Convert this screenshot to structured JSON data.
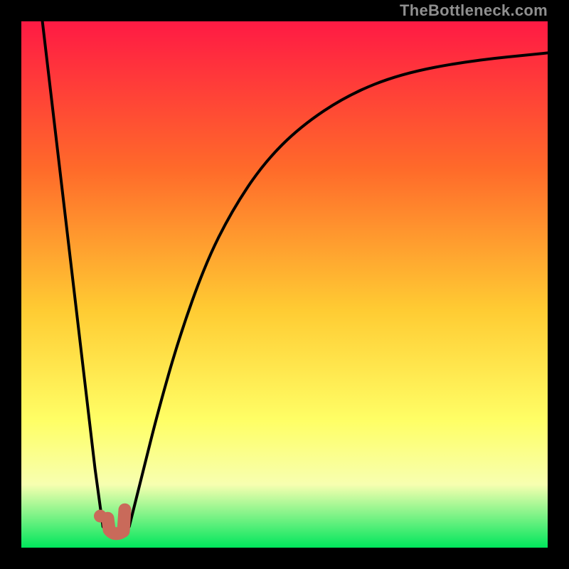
{
  "watermark": "TheBottleneck.com",
  "colors": {
    "frame": "#000000",
    "gradient_top": "#ff1a44",
    "gradient_mid1": "#ff6a2a",
    "gradient_mid2": "#ffcc33",
    "gradient_mid3": "#ffff66",
    "gradient_mid4": "#f7ffb0",
    "gradient_bottom": "#00e65c",
    "curve": "#000000",
    "marker_fill": "#c96a5a",
    "marker_stroke": "#c96a5a"
  },
  "chart_data": {
    "type": "line",
    "title": "",
    "xlabel": "",
    "ylabel": "",
    "xlim": [
      0,
      100
    ],
    "ylim": [
      0,
      100
    ],
    "note": "Values read from the plot in percent of plot width (x) and percent of plot height (y, 0 = bottom). Lower y = better (green).",
    "series": [
      {
        "name": "left-branch",
        "x": [
          4,
          6,
          8,
          10,
          12,
          14,
          15.5
        ],
        "y": [
          100,
          83,
          66,
          49,
          32,
          15,
          4
        ]
      },
      {
        "name": "valley",
        "x": [
          15.5,
          16.5,
          18,
          19.5,
          20.5
        ],
        "y": [
          4,
          3,
          2.5,
          3,
          4
        ]
      },
      {
        "name": "right-branch",
        "x": [
          20.5,
          23,
          26,
          30,
          35,
          40,
          46,
          53,
          62,
          72,
          85,
          100
        ],
        "y": [
          4,
          14,
          26,
          40,
          54,
          64,
          73,
          80,
          86,
          90,
          92.5,
          94
        ]
      }
    ],
    "marker": {
      "name": "optimum-dot",
      "x": 15,
      "y": 6
    },
    "j_marker": {
      "name": "optimum-j",
      "x": 17.5,
      "y": 4.5
    },
    "annotations": []
  }
}
